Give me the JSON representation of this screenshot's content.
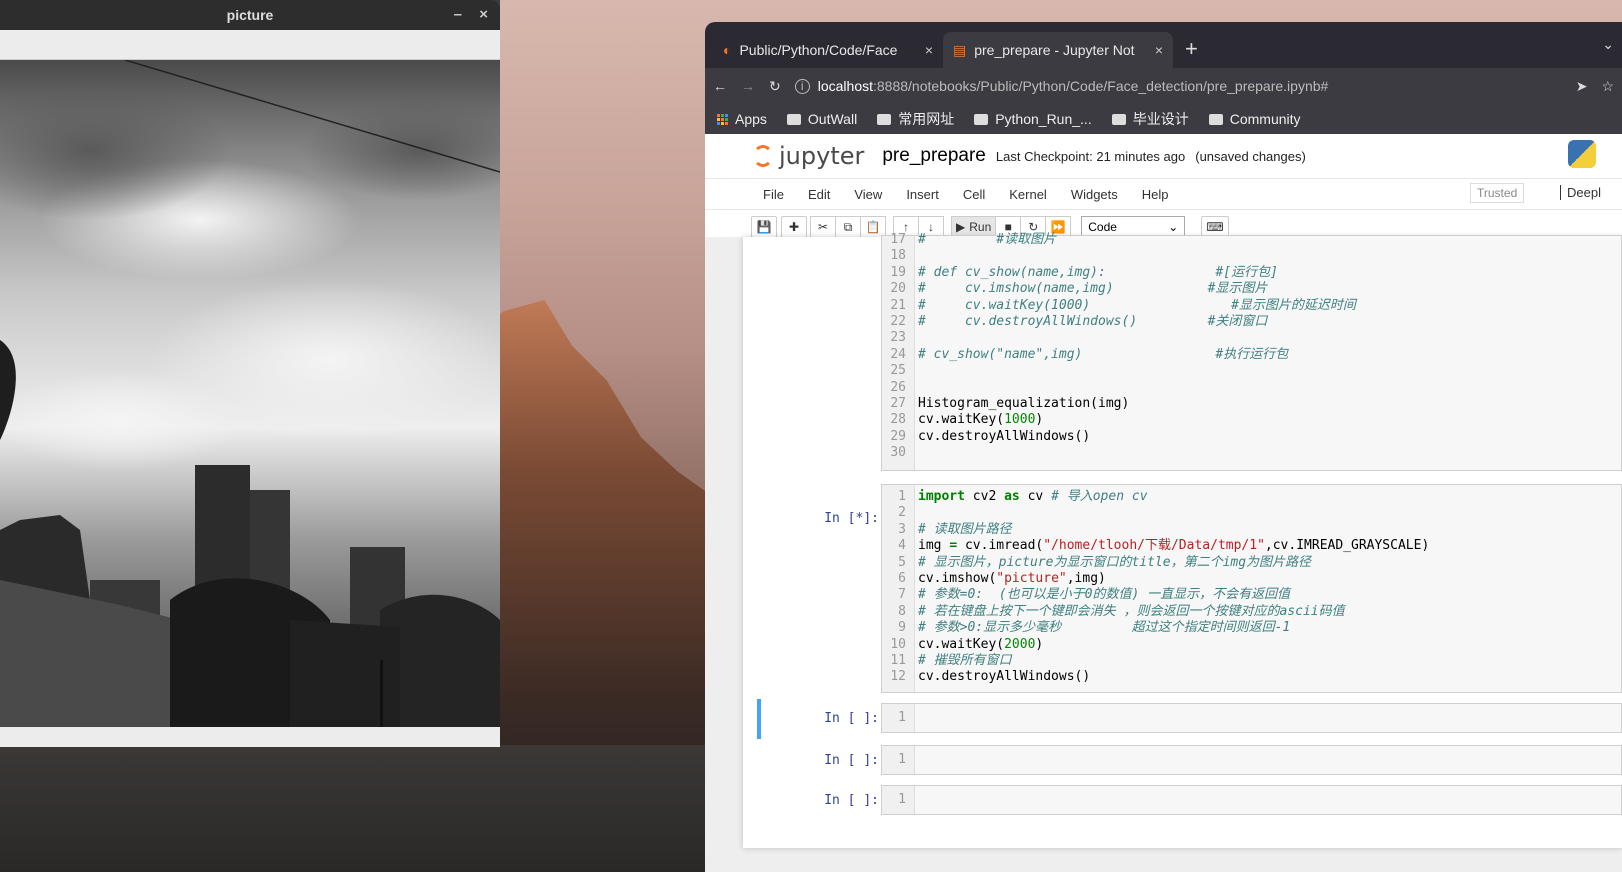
{
  "picture_window": {
    "title": "picture",
    "minimize": "–",
    "close": "×"
  },
  "browser": {
    "tabs": [
      {
        "title": "Public/Python/Code/Face",
        "close": "×"
      },
      {
        "title": "pre_prepare - Jupyter Not",
        "close": "×"
      }
    ],
    "new_tab": "+",
    "url_host": "localhost",
    "url_rest": ":8888/notebooks/Public/Python/Code/Face_detection/pre_prepare.ipynb#",
    "bookmarks": [
      "Apps",
      "OutWall",
      "常用网址",
      "Python_Run_...",
      "毕业设计",
      "Community"
    ]
  },
  "jupyter": {
    "logo_text": "jupyter",
    "notebook_name": "pre_prepare",
    "checkpoint": "Last Checkpoint: 21 minutes ago",
    "unsaved": "(unsaved changes)",
    "menu": [
      "File",
      "Edit",
      "View",
      "Insert",
      "Cell",
      "Kernel",
      "Widgets",
      "Help"
    ],
    "trusted": "Trusted",
    "kernel": "Deepl",
    "run_label": "Run",
    "cell_type": "Code"
  },
  "cells": {
    "cell1_lines": [
      {
        "n": "17",
        "text": "#         #读取图片"
      },
      {
        "n": "18",
        "text": ""
      },
      {
        "n": "19",
        "text": "# def cv_show(name,img):              #[运行包]"
      },
      {
        "n": "20",
        "text": "#     cv.imshow(name,img)            #显示图片"
      },
      {
        "n": "21",
        "text": "#     cv.waitKey(1000)                  #显示图片的延迟时间"
      },
      {
        "n": "22",
        "text": "#     cv.destroyAllWindows()         #关闭窗口"
      },
      {
        "n": "23",
        "text": ""
      },
      {
        "n": "24",
        "text": "# cv_show(\"name\",img)                 #执行运行包"
      },
      {
        "n": "25",
        "text": ""
      },
      {
        "n": "26",
        "text": ""
      },
      {
        "n": "27",
        "text": "Histogram_equalization(img)"
      },
      {
        "n": "28",
        "text": "cv.waitKey(1000)"
      },
      {
        "n": "29",
        "text": "cv.destroyAllWindows()"
      },
      {
        "n": "30",
        "text": ""
      }
    ],
    "cell2_prompt": "In [*]:",
    "cell2_lines": [
      {
        "n": "1",
        "text": "import cv2 as cv # 导入open cv"
      },
      {
        "n": "2",
        "text": ""
      },
      {
        "n": "3",
        "text": "# 读取图片路径"
      },
      {
        "n": "4",
        "text": "img = cv.imread(\"/home/tlooh/下载/Data/tmp/1\",cv.IMREAD_GRAYSCALE)"
      },
      {
        "n": "5",
        "text": "# 显示图片，picture为显示窗口的title，第二个img为图片路径"
      },
      {
        "n": "6",
        "text": "cv.imshow(\"picture\",img)"
      },
      {
        "n": "7",
        "text": "# 参数=0:  (也可以是小于0的数值) 一直显示，不会有返回值"
      },
      {
        "n": "8",
        "text": "# 若在键盘上按下一个键即会消失 ，则会返回一个按键对应的ascii码值"
      },
      {
        "n": "9",
        "text": "# 参数>0:显示多少毫秒         超过这个指定时间则返回-1"
      },
      {
        "n": "10",
        "text": "cv.waitKey(2000)"
      },
      {
        "n": "11",
        "text": "# 摧毁所有窗口"
      },
      {
        "n": "12",
        "text": "cv.destroyAllWindows()"
      }
    ],
    "empty_prompt": "In [ ]:",
    "empty_line_no": "1"
  }
}
